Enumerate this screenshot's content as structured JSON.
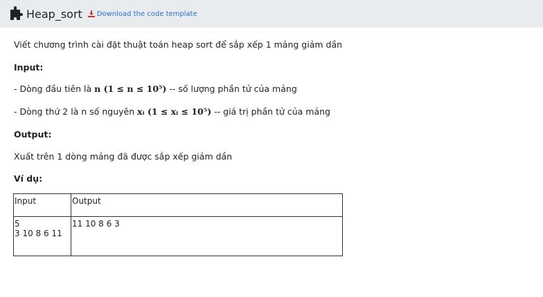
{
  "header": {
    "title": "Heap_sort",
    "download_label": "Download the code template"
  },
  "problem": {
    "description": "Viết chương trình cài đặt thuật toán heap sort để sắp xếp 1 mảng giảm dần",
    "input_heading": "Input:",
    "input_line1_prefix": "- Dòng đầu tiên là",
    "input_line1_math": "n (1 ≤ n ≤ 10⁵)",
    "input_line1_suffix": "-- số lượng phần tử của mảng",
    "input_line2_prefix": "- Dòng thứ 2 là n số nguyên",
    "input_line2_math": "xᵢ  (1 ≤ xᵢ ≤ 10⁵)",
    "input_line2_suffix": "-- giá trị phần tử của mảng",
    "output_heading": "Output:",
    "output_desc": "Xuất trên 1 dòng mảng đã được sắp xếp giảm dần",
    "example_heading": "Ví dụ:"
  },
  "example_table": {
    "headers": [
      "Input",
      "Output"
    ],
    "rows": [
      {
        "input_line1": "5",
        "input_line2": "3 10 8 6 11",
        "output": "11 10 8 6 3"
      }
    ]
  }
}
